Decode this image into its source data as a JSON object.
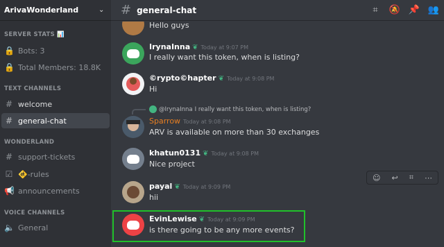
{
  "server": {
    "name": "ArivaWonderland"
  },
  "sidebar": {
    "categories": [
      "SERVER STATS 📊",
      "TEXT CHANNELS",
      "WONDERLAND",
      "VOICE CHANNELS"
    ],
    "stats": [
      "Bots: 3",
      "Total Members: 18.8K"
    ],
    "text_channels": [
      "welcome",
      "general-chat"
    ],
    "wonderland": [
      "support-tickets",
      "🚸-rules",
      "announcements"
    ],
    "voice": [
      "General"
    ]
  },
  "header": {
    "title": "general-chat"
  },
  "messages": [
    {
      "user": "",
      "text": "Hello guys",
      "time": ""
    },
    {
      "user": "IrynaInna",
      "text": "I really want this token, when is listing?",
      "time": "Today at 9:07 PM",
      "avatar_color": "#3ba55c"
    },
    {
      "user": "©rypto©hapter",
      "text": "Hi",
      "time": "Today at 9:08 PM"
    },
    {
      "reply_user": "@IrynaInna",
      "reply_text": "I really want this token, when is listing?",
      "user": "Sparrow",
      "text": "ARV is available on more than 30 exchanges",
      "time": "Today at 9:08 PM",
      "name_color": "#e67e22"
    },
    {
      "user": "khatun0131",
      "text": "Nice project",
      "time": "Today at 9:08 PM",
      "avatar_color": "#747f8d"
    },
    {
      "user": "payal",
      "text": "hii",
      "time": "Today at 9:09 PM"
    },
    {
      "user": "EvinLewise",
      "text": "is there going to be any more events?",
      "time": "Today at 9:09 PM",
      "avatar_color": "#ed4245"
    }
  ],
  "colors": {
    "highlight": "#20c12a",
    "online": "#43b581"
  }
}
